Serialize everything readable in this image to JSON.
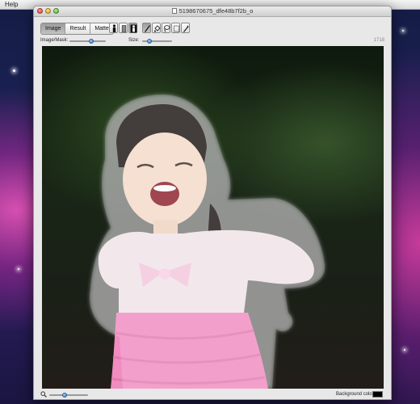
{
  "menubar": {
    "help_label": "Help"
  },
  "window": {
    "title": "5198670675_dfe48b7f2b_o"
  },
  "toolbar": {
    "view_modes": [
      "Image",
      "Result",
      "Matte"
    ],
    "active_view": "Image",
    "image_mask_label": "Image/Mask:",
    "image_mask_level": 0.6,
    "size_label": "Size:",
    "size_level": 0.25,
    "size_value": "1718"
  },
  "tools": [
    "foreground-figure-icon",
    "unknown-region-icon",
    "background-figure-icon",
    "brush-icon",
    "paint-bucket-icon",
    "lasso-icon",
    "rectangle-select-icon",
    "magic-wand-icon"
  ],
  "bottom": {
    "zoom_level": 0.4,
    "background_color_label": "Background color:",
    "background_color": "#000000"
  },
  "colors": {
    "accent": "#2a73c9",
    "mask_overlay": "#c8c8c8",
    "dress_pink": "#f08cc0"
  }
}
